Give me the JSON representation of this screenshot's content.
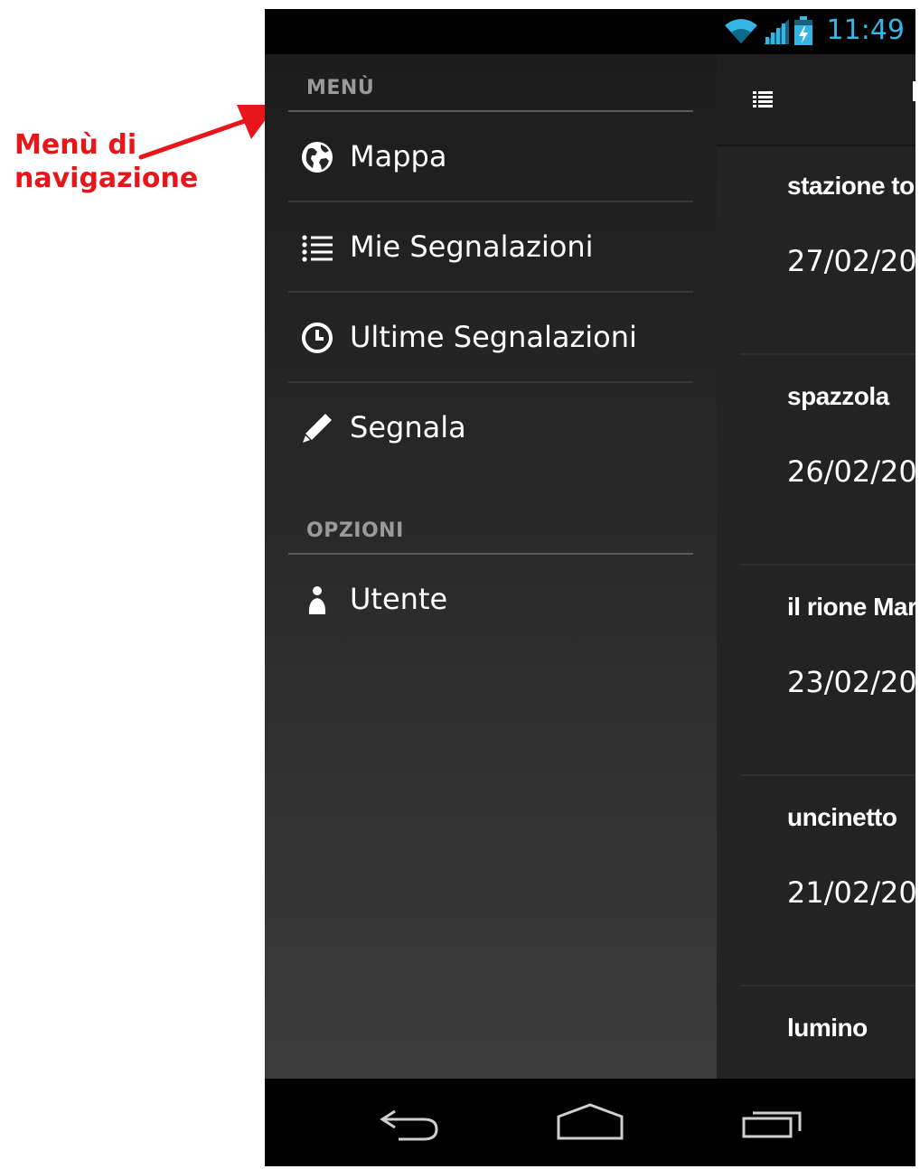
{
  "annotation": {
    "line1": "Menù di",
    "line2": "navigazione",
    "color": "#e8161b"
  },
  "status_bar": {
    "time": "11:49",
    "icons": [
      "wifi-icon",
      "signal-icon",
      "battery-charging-icon"
    ],
    "accent": "#33b5e5"
  },
  "drawer": {
    "menu_header": "MENÙ",
    "menu_items": [
      {
        "label": "Mappa",
        "icon": "globe-icon"
      },
      {
        "label": "Mie Segnalazioni",
        "icon": "list-icon"
      },
      {
        "label": "Ultime Segnalazioni",
        "icon": "clock-icon"
      },
      {
        "label": "Segnala",
        "icon": "pencil-icon"
      }
    ],
    "options_header": "OPZIONI",
    "options_items": [
      {
        "label": "Utente",
        "icon": "user-icon"
      }
    ]
  },
  "content": {
    "action_icon": "list-menu-icon",
    "reports": [
      {
        "title": "stazione to",
        "date": "27/02/20"
      },
      {
        "title": "spazzola",
        "date": "26/02/20"
      },
      {
        "title": "il rione Mar",
        "date": "23/02/20"
      },
      {
        "title": "uncinetto",
        "date": "21/02/20"
      },
      {
        "title": "lumino",
        "date": ""
      }
    ]
  },
  "nav_bar": {
    "buttons": [
      "back-icon",
      "home-icon",
      "recent-apps-icon"
    ]
  }
}
